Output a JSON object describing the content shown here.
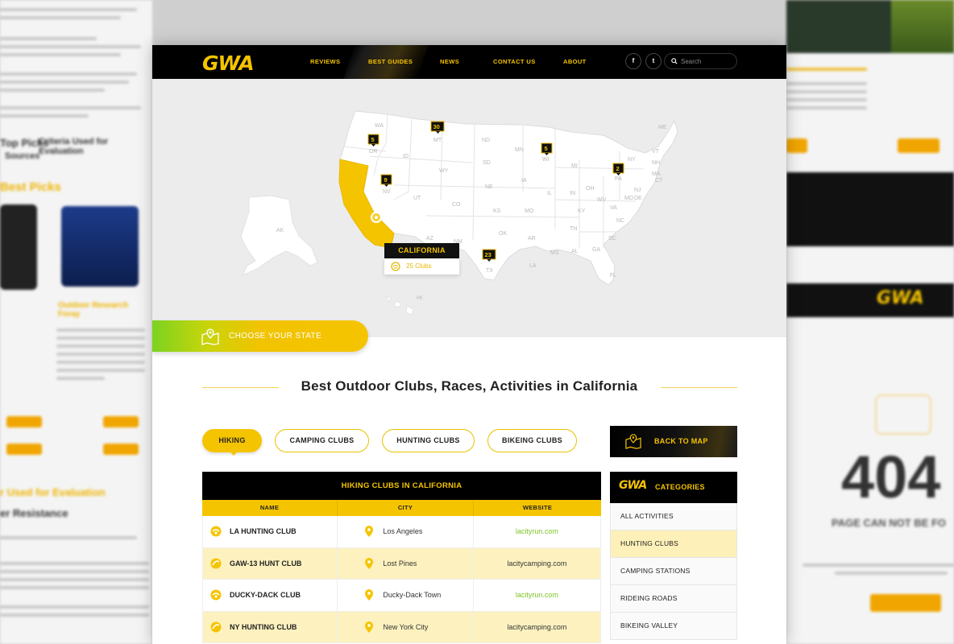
{
  "nav": {
    "logo": "GWA",
    "items": [
      "REVIEWS",
      "BEST GUIDES",
      "NEWS",
      "CONTACT US",
      "ABOUT"
    ],
    "active": "BEST GUIDES",
    "social": [
      {
        "icon": "facebook-icon",
        "glyph": "f"
      },
      {
        "icon": "twitter-icon",
        "glyph": "t"
      }
    ],
    "search_placeholder": "Search"
  },
  "map": {
    "state_labels": [
      "WA",
      "OR",
      "ID",
      "MT",
      "ND",
      "SD",
      "WY",
      "NE",
      "NV",
      "UT",
      "CO",
      "KS",
      "OK",
      "TX",
      "AZ",
      "NM",
      "MN",
      "IA",
      "MO",
      "AR",
      "LA",
      "WI",
      "IL",
      "MI",
      "IN",
      "OH",
      "KY",
      "TN",
      "MS",
      "AL",
      "GA",
      "FL",
      "SC",
      "NC",
      "VA",
      "WV",
      "PA",
      "NY",
      "VT",
      "NH",
      "ME",
      "MA",
      "CT",
      "NJ",
      "DE",
      "MD",
      "AK",
      "HI"
    ],
    "pins": [
      {
        "state": "OR",
        "count": "5"
      },
      {
        "state": "MT",
        "count": "30"
      },
      {
        "state": "NV",
        "count": "9"
      },
      {
        "state": "WI",
        "count": "5"
      },
      {
        "state": "PA",
        "count": "2"
      },
      {
        "state": "TX",
        "count": "23"
      }
    ],
    "selected_state": "CALIFORNIA",
    "selected_clubs": "25 Clubs",
    "choose_state_label": "CHOOSE YOUR STATE"
  },
  "section_title": "Best Outdoor Clubs, Races, Activities in California",
  "tabs": [
    "HIKING",
    "CAMPING CLUBS",
    "HUNTING CLUBS",
    "BIKEING CLUBS"
  ],
  "active_tab": "HIKING",
  "back_to_map": "BACK TO MAP",
  "table": {
    "title": "HIKING CLUBS IN CALIFORNIA",
    "columns": [
      "NAME",
      "CITY",
      "WEBSITE"
    ],
    "rows": [
      {
        "name": "LA HUNTING CLUB",
        "city": "Los Angeles",
        "website": "lacityrun.com"
      },
      {
        "name": "GAW-13 HUNT CLUB",
        "city": "Lost Pines",
        "website": "lacitycamping.com"
      },
      {
        "name": "DUCKY-DACK CLUB",
        "city": "Ducky-Dack Town",
        "website": "lacityrun.com"
      },
      {
        "name": "NY HUNTING CLUB",
        "city": "New York City",
        "website": "lacitycamping.com"
      }
    ]
  },
  "categories": {
    "logo": "GWA",
    "title": "CATEGORIES",
    "items": [
      "ALL ACTIVITIES",
      "HUNTING CLUBS",
      "CAMPING STATIONS",
      "RIDEING ROADS",
      "BIKEING VALLEY"
    ],
    "active": "HUNTING CLUBS"
  },
  "colors": {
    "brand_yellow": "#f5c400",
    "dark": "#000000",
    "accent_green": "#7fc424"
  },
  "background": {
    "left_headings": [
      "Top Picks",
      "Criteria Used for Evaluation",
      "Sources",
      "Best Picks",
      "Outdoor Research Foray",
      "r Used for Evaluation",
      "er Resistance"
    ],
    "right_labels": [
      "404",
      "PAGE CAN NOT BE FO"
    ],
    "right_logo": "GWA"
  }
}
